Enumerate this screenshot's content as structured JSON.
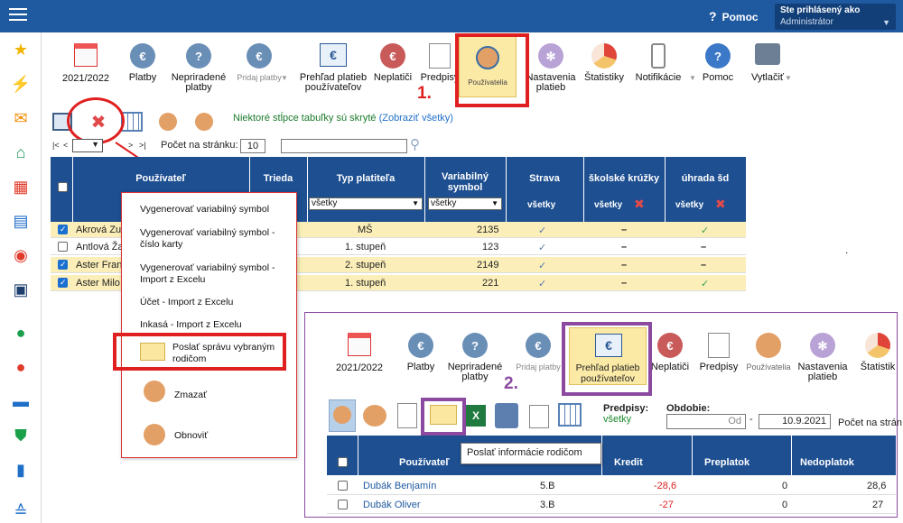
{
  "topbar": {
    "help": "Pomoc",
    "user_line1": "Ste prihlásený ako",
    "user_line2": "Administrátor"
  },
  "sidebar": {
    "icons": [
      "star-icon",
      "magic-wand-icon",
      "mail-icon",
      "home-icon",
      "calendar-icon",
      "book-icon",
      "user-circle-icon",
      "clipboard-icon",
      "check-icon",
      "rocket-icon",
      "briefcase-icon",
      "shield-icon",
      "chart-icon",
      "layers-icon"
    ]
  },
  "toolbar": {
    "year": "2021/2022",
    "items": [
      "Platby",
      "Nepriradené platby",
      "Pridaj platby",
      "Prehľad platieb používateľov",
      "Neplatiči",
      "Predpisy",
      "Používatelia",
      "Nastavenia platieb",
      "Štatistiky",
      "Notifikácie",
      "Pomoc",
      "Vytlačiť"
    ],
    "marker1": "1."
  },
  "subbar": {
    "hidden_cols_text": "Niektoré stĺpce tabuľky sú skryté",
    "show_all": "(Zobraziť všetky)"
  },
  "pager": {
    "first": "|<",
    "prev": "<",
    "next": ">",
    "last": ">|",
    "per_page_label": "Počet na stránku:",
    "per_page": "10",
    "page_value": ""
  },
  "grid": {
    "headers": [
      "Používateľ",
      "Trieda",
      "Typ platiteľa",
      "Variabilný symbol",
      "Strava",
      "školské krúžky",
      "úhrada šd"
    ],
    "filter_all": "všetky",
    "rows": [
      {
        "name": "Akrová Zuz",
        "typ": "MŠ",
        "vs": "2135",
        "strava": "✓",
        "kruzky": "–",
        "sd": "✓",
        "checked": true
      },
      {
        "name": "Antlová Ža",
        "typ": "1. stupeň",
        "vs": "123",
        "strava": "✓",
        "kruzky": "–",
        "sd": "–",
        "checked": false
      },
      {
        "name": "Aster Fran",
        "typ": "2. stupeň",
        "vs": "2149",
        "strava": "✓",
        "kruzky": "–",
        "sd": "–",
        "checked": true
      },
      {
        "name": "Aster Milo",
        "typ": "1. stupeň",
        "vs": "221",
        "strava": "✓",
        "kruzky": "–",
        "sd": "✓",
        "checked": true
      }
    ]
  },
  "popup": {
    "items": [
      "Vygenerovať variabilný symbol",
      "Vygenerovať variabilný symbol - číslo karty",
      "Vygenerovať variabilný symbol - Import z Excelu",
      "Účet - Import z Excelu",
      "Inkasá - Import z Excelu",
      "Poslať správu vybraným rodičom",
      "Zmazať",
      "Obnoviť"
    ]
  },
  "inset": {
    "toolbar": {
      "year": "2021/2022",
      "items": [
        "Platby",
        "Nepriradené platby",
        "Pridaj platby",
        "Prehľad platieb používateľov",
        "Neplatiči",
        "Predpisy",
        "Používatelia",
        "Nastavenia platieb",
        "Štatistik"
      ]
    },
    "marker2": "2.",
    "predpisy_label": "Predpisy:",
    "predpisy_value": "všetky",
    "obdobie_label": "Obdobie:",
    "od": "Od",
    "do": "10.9.2021",
    "pocet": "Počet na strán",
    "tooltip": "Poslať informácie rodičom",
    "headers": [
      "Používateľ",
      "Kredit",
      "Preplatok",
      "Nedoplatok"
    ],
    "rows": [
      {
        "name": "Dubák Benjamín",
        "trieda": "5.B",
        "kredit": "-28,6",
        "preplatok": "0",
        "nedoplatok": "28,6"
      },
      {
        "name": "Dubák Oliver",
        "trieda": "3.B",
        "kredit": "-27",
        "preplatok": "0",
        "nedoplatok": "27"
      }
    ]
  },
  "colors": {
    "brand": "#1f5aa0",
    "header": "#1d4f91",
    "highlight": "#fbeeb8",
    "red": "#e02020",
    "purple": "#8b4aa0"
  }
}
